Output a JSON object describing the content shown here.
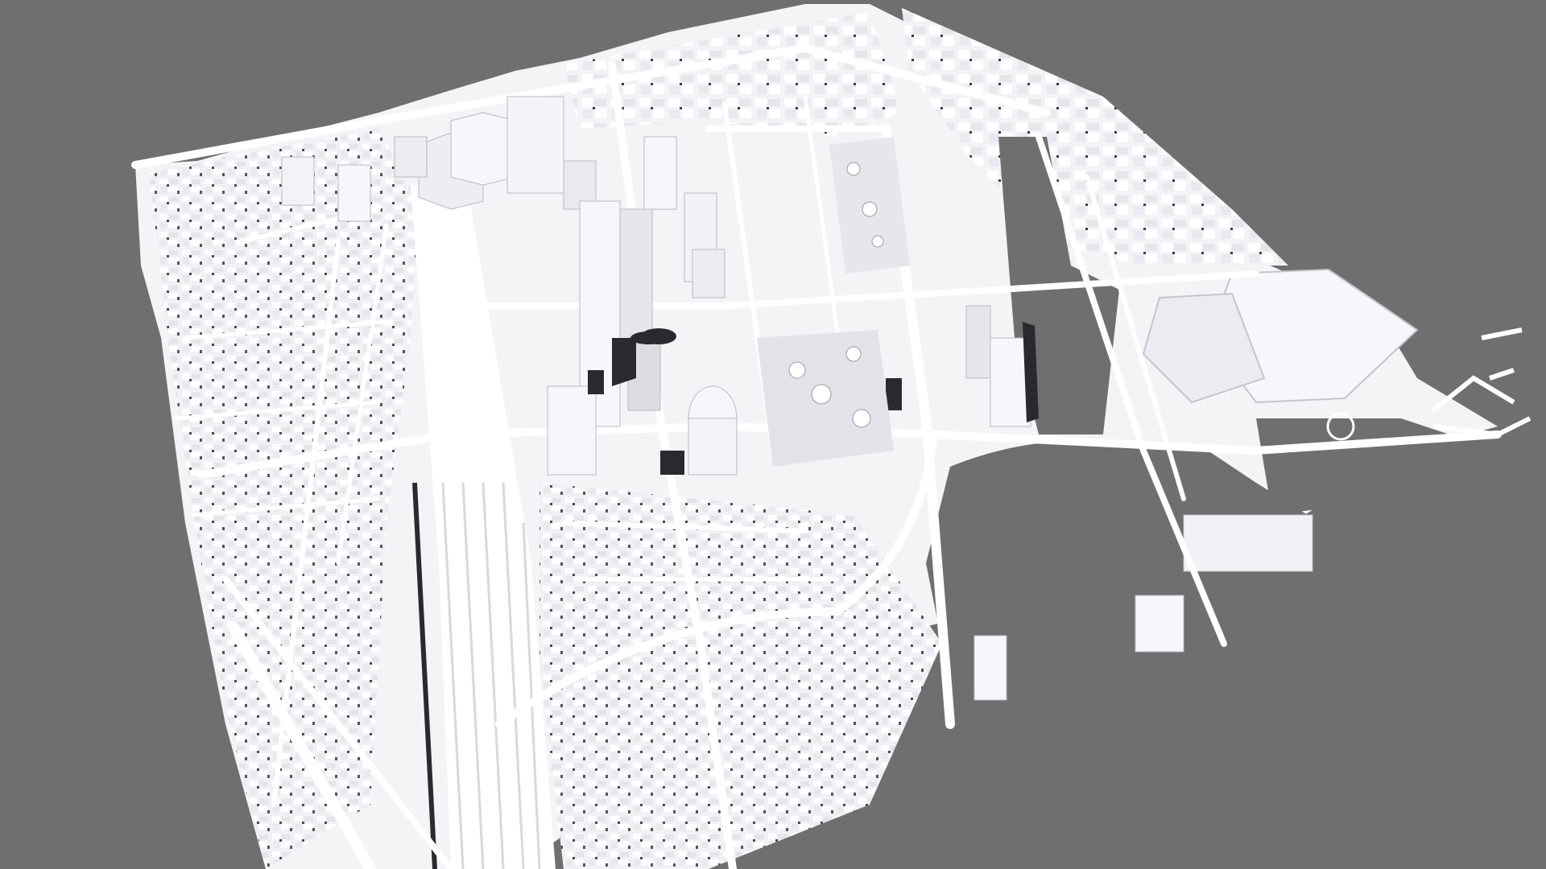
{
  "scene": {
    "kind": "3d-city-model",
    "view": "oblique-aerial",
    "colors": {
      "background": "#6f6f6f",
      "ground": "#f4f4f7",
      "building_top": "#f7f6fb",
      "building_side": "#dcdce3",
      "building_shade": "#c4c4cc",
      "shadow": "#2a2a2e",
      "water": "#6f6f6f",
      "road": "#ffffff"
    },
    "features": [
      "city-blocks",
      "high-rise-towers",
      "rail-corridor",
      "street-network",
      "river-channel",
      "exhibition-halls",
      "urban-park",
      "tree-clusters"
    ]
  }
}
